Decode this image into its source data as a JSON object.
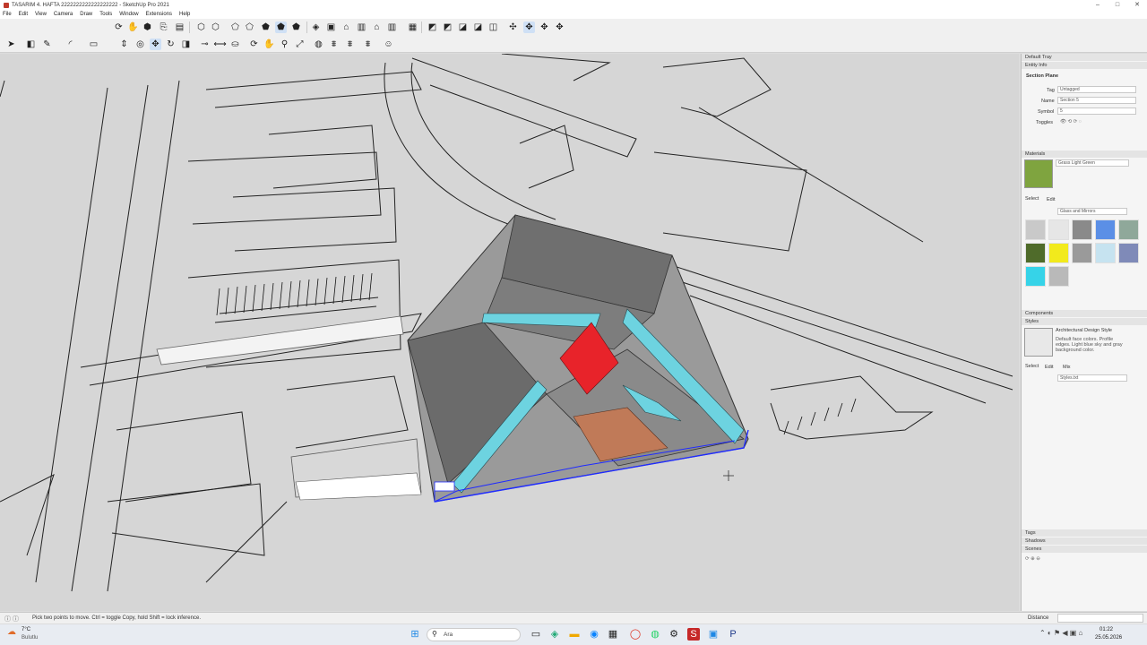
{
  "window": {
    "title": "TASARIM 4. HAFTA 2222222222222222222 - SketchUp Pro 2021",
    "controls": [
      "–",
      "□",
      "✕"
    ]
  },
  "menu": [
    "File",
    "Edit",
    "View",
    "Camera",
    "Draw",
    "Tools",
    "Window",
    "Extensions",
    "Help"
  ],
  "tray": {
    "title": "Default Tray",
    "entity_info": {
      "header": "Entity Info",
      "type": "Section Plane",
      "tag_label": "Tag",
      "tag_value": "Untagged",
      "name_label": "Name",
      "name_value": "Section 5",
      "symbol_label": "Symbol",
      "symbol_value": "5",
      "toggles_label": "Toggles"
    },
    "materials": {
      "header": "Materials",
      "current": "Grass Light Green",
      "select_tab": "Select",
      "edit_tab": "Edit",
      "collection": "Glass and Mirrors",
      "swatch_colors": [
        "#c9c9c9",
        "#e6e6e6",
        "#8a8a8a",
        "#5b8fe6",
        "#8fa89a",
        "#4f6b2a",
        "#f2ea1c",
        "#9a9a9a",
        "#c6e3f0",
        "#7f8ab8",
        "#36d3e8",
        "#b9b9b9"
      ]
    },
    "components": {
      "header": "Components"
    },
    "styles": {
      "header": "Styles",
      "name": "Architectural Design Style",
      "description": "Default face colors. Profile edges. Light blue sky and gray background color.",
      "select_tab": "Select",
      "edit_tab": "Edit",
      "mix_tab": "Mix",
      "collection": "Styles.txt"
    },
    "tags": {
      "header": "Tags"
    },
    "shadows": {
      "header": "Shadows"
    },
    "scenes": {
      "header": "Scenes"
    }
  },
  "status": {
    "hint": "Pick two points to move.  Ctrl = toggle Copy, hold Shift = lock inference.",
    "measurement_label": "Distance"
  },
  "taskbar": {
    "weather_temp": "7°C",
    "weather_desc": "Bulutlu",
    "search_placeholder": "Ara",
    "time": "01:22",
    "date": "25.05.2026"
  },
  "colors": {
    "accent_red": "#e8232a",
    "glass_cyan": "#6dd3e0",
    "roof_gray": "#7a7a7a",
    "selection_blue": "#1f2bff",
    "wood": "#c07a58"
  }
}
